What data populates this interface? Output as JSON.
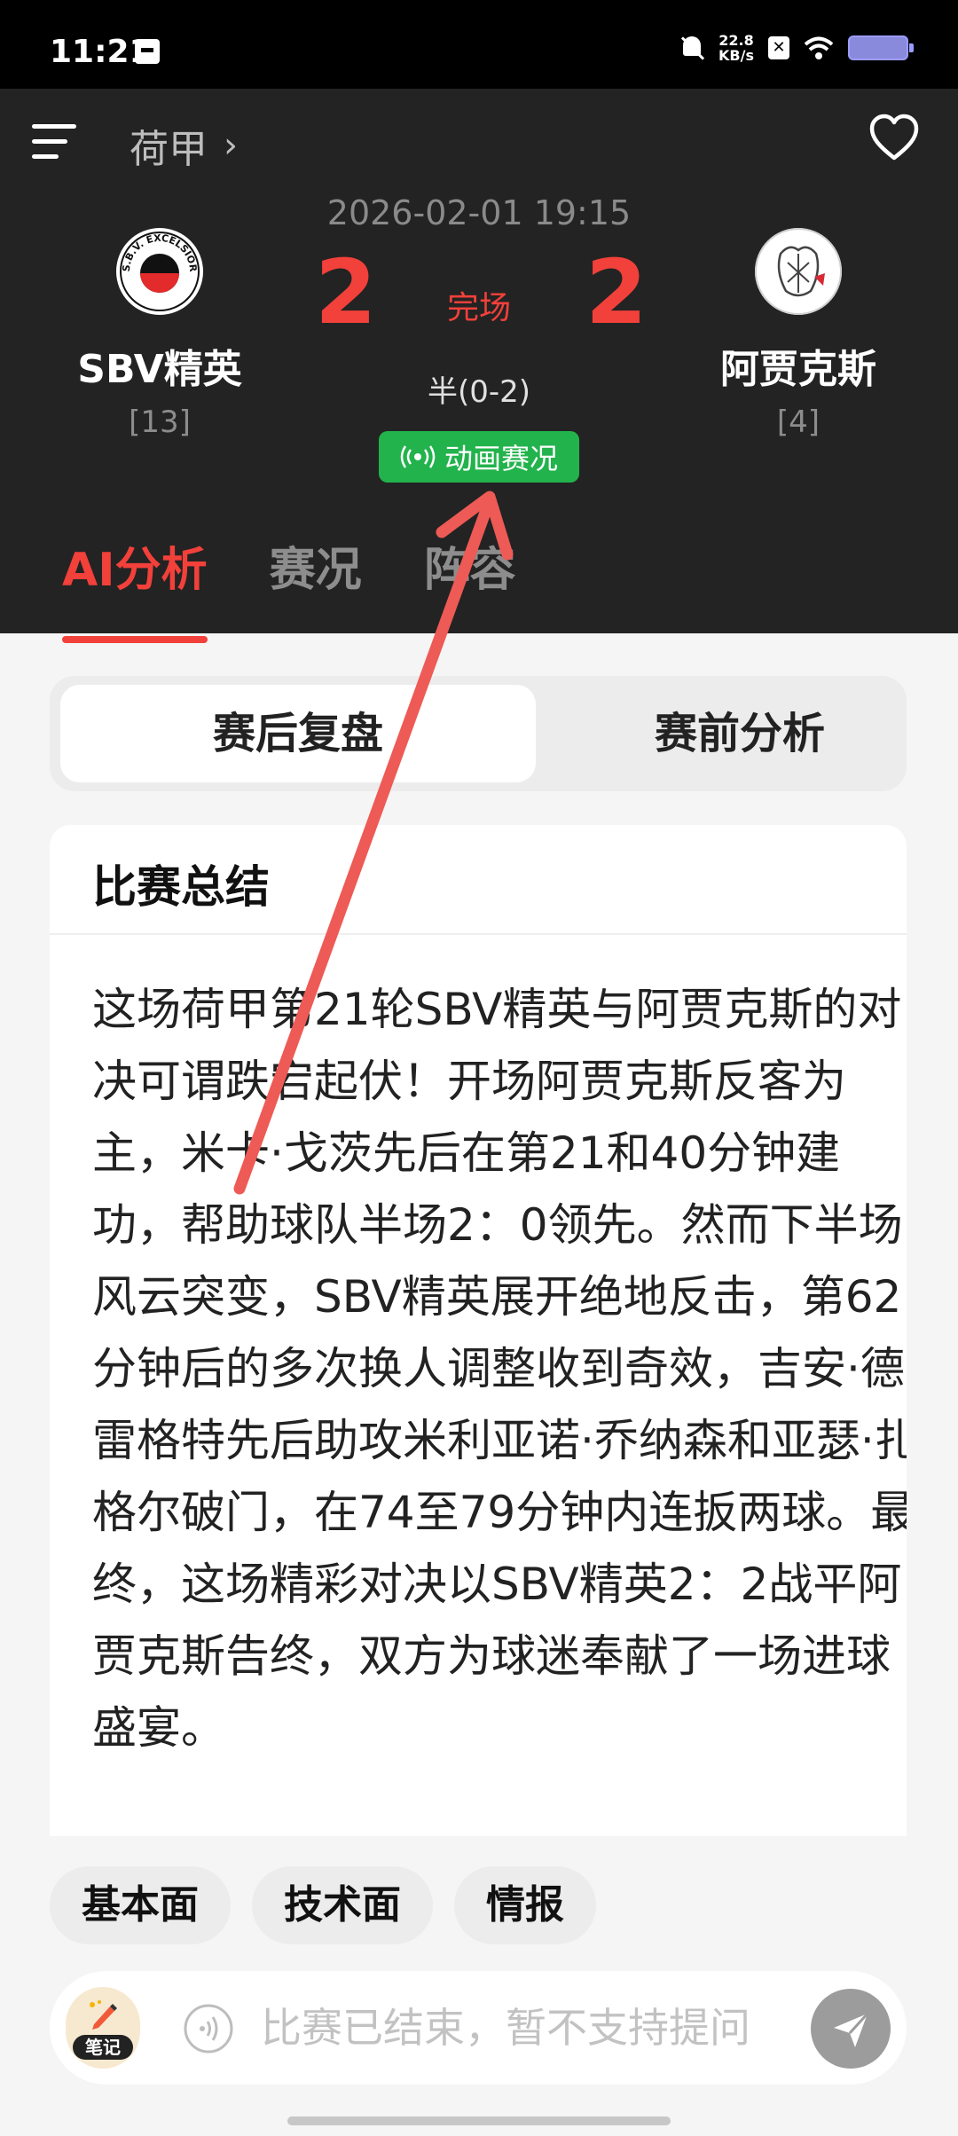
{
  "status_bar": {
    "time": "11:21",
    "net_speed_value": "22.8",
    "net_speed_unit": "KB/s"
  },
  "header": {
    "league": "荷甲",
    "match_time": "2026-02-01 19:15",
    "status": "完场",
    "half_score": "半(0-2)",
    "animation_button": "动画赛况",
    "home": {
      "name": "SBV精英",
      "rank": "[13]",
      "score": "2",
      "logo_text": "S.B.V. EXCELSIOR"
    },
    "away": {
      "name": "阿贾克斯",
      "rank": "[4]",
      "score": "2"
    }
  },
  "tabs": [
    "AI分析",
    "赛况",
    "阵容"
  ],
  "segments": {
    "post": "赛后复盘",
    "pre": "赛前分析"
  },
  "summary": {
    "title": "比赛总结",
    "body": "这场荷甲第21轮SBV精英与阿贾克斯的对决可谓跌宕起伏！开场阿贾克斯反客为主，米卡·戈茨先后在第21和40分钟建功，帮助球队半场2：0领先。然而下半场风云突变，SBV精英展开绝地反击，第62分钟后的多次换人调整收到奇效，吉安·德·雷格特先后助攻米利亚诺·乔纳森和亚瑟·扎格尔破门，在74至79分钟内连扳两球。最终，这场精彩对决以SBV精英2：2战平阿贾克斯告终，双方为球迷奉献了一场进球盛宴。"
  },
  "chips": [
    "基本面",
    "技术面",
    "情报"
  ],
  "input_bar": {
    "note_label": "笔记",
    "placeholder": "比赛已结束，暂不支持提问"
  },
  "colors": {
    "accent_red": "#f2403a",
    "live_green": "#22b34c",
    "header_bg": "#232323",
    "annotation_arrow": "#ee5a55"
  },
  "icons": [
    "menu-icon",
    "chevron-right-icon",
    "heart-icon",
    "broadcast-icon",
    "pen-icon",
    "voice-icon",
    "send-icon"
  ]
}
